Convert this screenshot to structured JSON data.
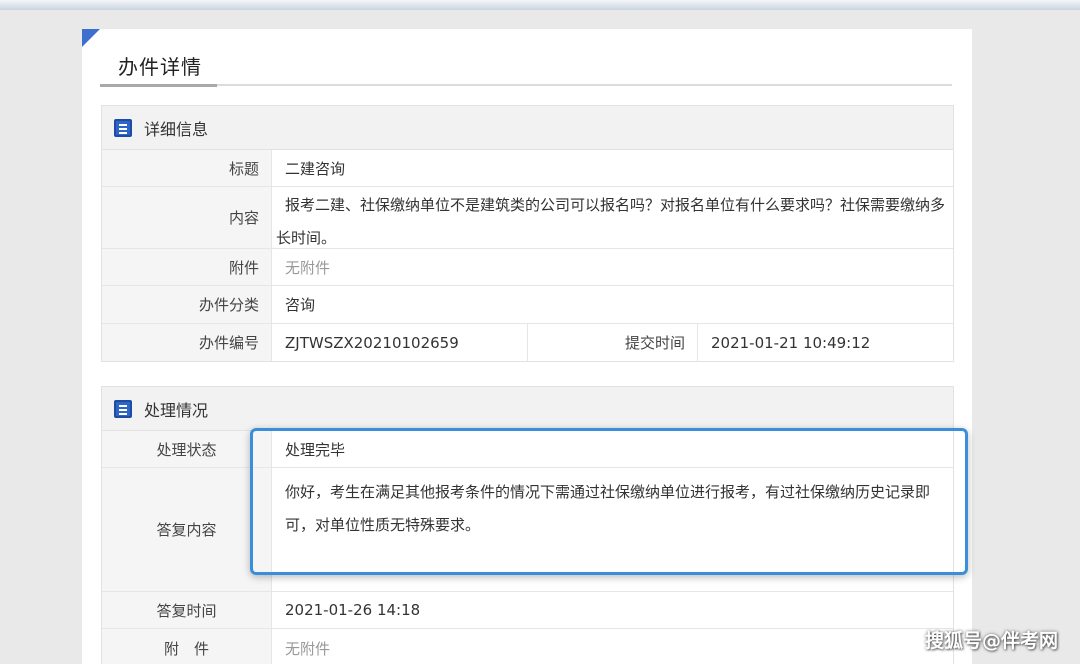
{
  "page": {
    "title": "办件详情"
  },
  "detail": {
    "section_title": "详细信息",
    "rows": {
      "title_label": "标题",
      "title_value": "二建咨询",
      "content_label": "内容",
      "content_value": "报考二建、社保缴纳单位不是建筑类的公司可以报名吗？对报名单位有什么要求吗？社保需要缴纳多长时间。",
      "attachment_label": "附件",
      "attachment_value": "无附件",
      "category_label": "办件分类",
      "category_value": "咨询",
      "number_label": "办件编号",
      "number_value": "ZJTWSZX20210102659",
      "submit_time_label": "提交时间",
      "submit_time_value": "2021-01-21 10:49:12"
    }
  },
  "handling": {
    "section_title": "处理情况",
    "rows": {
      "status_label": "处理状态",
      "status_value": "处理完毕",
      "reply_label": "答复内容",
      "reply_value": "你好，考生在满足其他报考条件的情况下需通过社保缴纳单位进行报考，有过社保缴纳历史记录即可，对单位性质无特殊要求。",
      "reply_time_label": "答复时间",
      "reply_time_value": "2021-01-26 14:18",
      "attachment_label": "附　件",
      "attachment_value": "无附件"
    }
  },
  "watermark": "搜狐号@伴考网",
  "colors": {
    "accent": "#3d6fd1",
    "highlight_border": "#3b8fd8",
    "label_bg": "#f5f5f5"
  },
  "icons": {
    "section_icon": "list-document-icon"
  }
}
